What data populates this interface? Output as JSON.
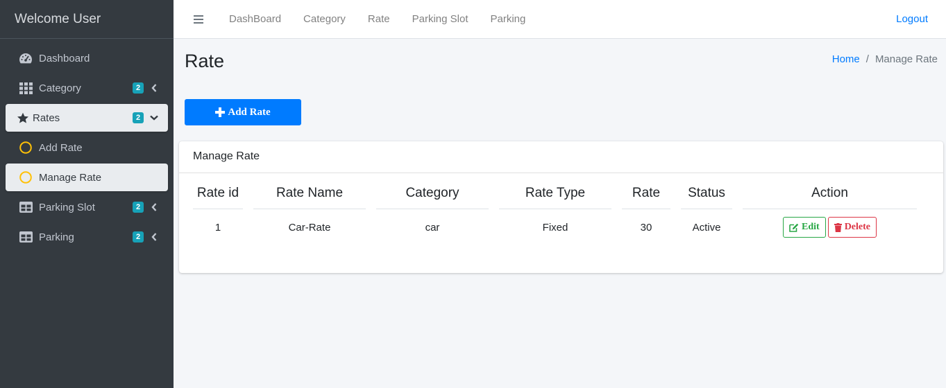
{
  "sidebar": {
    "brand": "Welcome User",
    "items": [
      {
        "label": "Dashboard",
        "icon": "dashboard-icon"
      },
      {
        "label": "Category",
        "icon": "grid-icon",
        "badge": "2"
      },
      {
        "label": "Rates",
        "icon": "star-icon",
        "badge": "2"
      },
      {
        "label": "Add Rate",
        "icon": "circle-icon"
      },
      {
        "label": "Manage Rate",
        "icon": "circle-icon"
      },
      {
        "label": "Parking Slot",
        "icon": "table-icon",
        "badge": "2"
      },
      {
        "label": "Parking",
        "icon": "table-icon",
        "badge": "2"
      }
    ]
  },
  "topbar": {
    "links": [
      "DashBoard",
      "Category",
      "Rate",
      "Parking Slot",
      "Parking"
    ],
    "logout": "Logout"
  },
  "page": {
    "title": "Rate",
    "breadcrumb": {
      "home": "Home",
      "separator": "/",
      "current": "Manage Rate"
    },
    "add_button": "Add Rate"
  },
  "card": {
    "title": "Manage Rate",
    "columns": [
      "Rate id",
      "Rate Name",
      "Category",
      "Rate Type",
      "Rate",
      "Status",
      "Action"
    ],
    "rows": [
      {
        "id": "1",
        "name": "Car-Rate",
        "category": "car",
        "type": "Fixed",
        "rate": "30",
        "status": "Active"
      }
    ],
    "edit_label": "Edit",
    "delete_label": "Delete"
  },
  "colors": {
    "sidebar_bg": "#343a40",
    "primary": "#007bff",
    "badge": "#17a2b8",
    "circle_icon": "#ffc107",
    "edit": "#28a745",
    "delete": "#dc3545"
  }
}
